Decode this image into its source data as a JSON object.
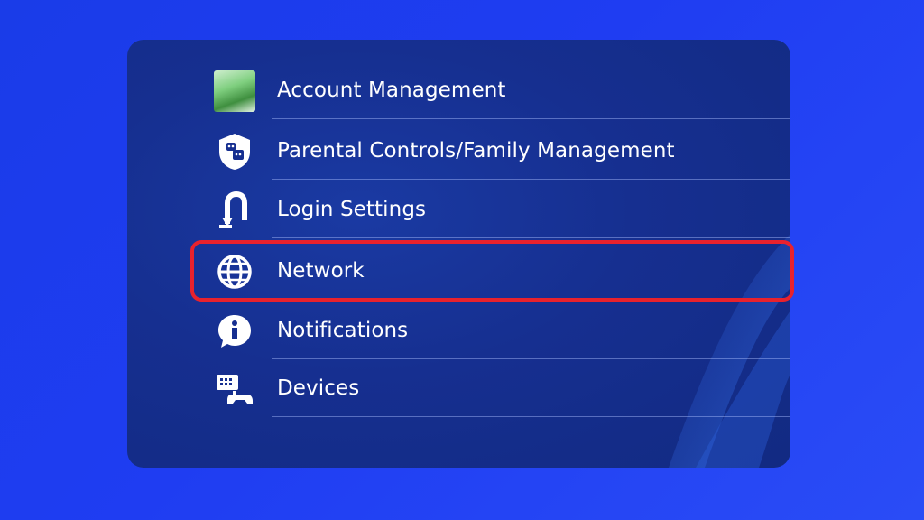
{
  "menu": {
    "items": [
      {
        "label": "Account Management",
        "icon": "avatar"
      },
      {
        "label": "Parental Controls/Family Management",
        "icon": "family-icon"
      },
      {
        "label": "Login Settings",
        "icon": "login-icon"
      },
      {
        "label": "Network",
        "icon": "globe-icon"
      },
      {
        "label": "Notifications",
        "icon": "info-icon"
      },
      {
        "label": "Devices",
        "icon": "devices-icon"
      }
    ],
    "selected": "Network"
  },
  "colors": {
    "background": "#1f3df2",
    "panel": "#162f90",
    "highlight": "#e8222d",
    "text": "#ffffff"
  }
}
